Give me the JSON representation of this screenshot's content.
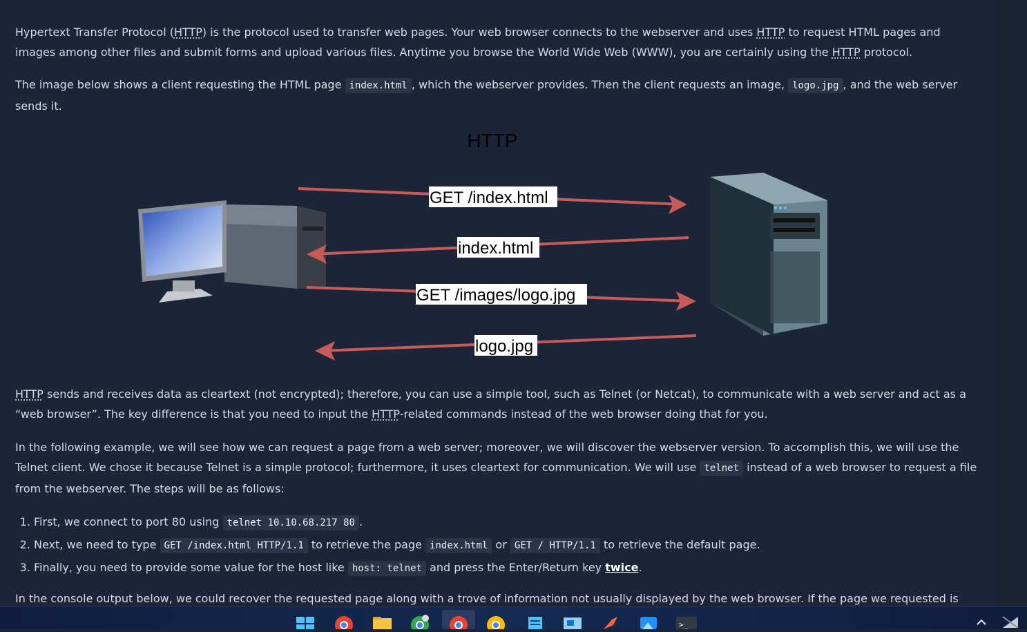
{
  "article": {
    "p1_a": "Hypertext Transfer Protocol (",
    "p1_abbr": "HTTP",
    "p1_b": ") is the protocol used to transfer web pages. Your web browser connects to the webserver and uses ",
    "p1_c": " to request HTML pages and images among other files and submit forms and upload various files. Anytime you browse the World Wide Web (WWW), you are certainly using the ",
    "p1_d": " protocol.",
    "p2_a": "The image below shows a client requesting the HTML page ",
    "p2_code1": "index.html",
    "p2_b": ", which the webserver provides. Then the client requests an image, ",
    "p2_code2": "logo.jpg",
    "p2_c": ", and the web server sends it.",
    "p3_a": " sends and receives data as cleartext (not encrypted); therefore, you can use a simple tool, such as Telnet (or Netcat), to communicate with a web server and act as a “web browser”. The key difference is that you need to input the ",
    "p3_b": "-related commands instead of the web browser doing that for you.",
    "p4_a": "In the following example, we will see how we can request a page from a web server; moreover, we will discover the webserver version. To accomplish this, we will use the Telnet client. We chose it because Telnet is a simple protocol; furthermore, it uses cleartext for communication. We will use ",
    "p4_code": "telnet",
    "p4_b": " instead of a web browser to request a file from the webserver. The steps will be as follows:",
    "li1_a": "First, we connect to port 80 using ",
    "li1_code": "telnet 10.10.68.217 80",
    "li1_b": ".",
    "li2_a": "Next, we need to type ",
    "li2_code1": "GET /index.html HTTP/1.1",
    "li2_b": " to retrieve the page ",
    "li2_code2": "index.html",
    "li2_c": " or ",
    "li2_code3": "GET / HTTP/1.1",
    "li2_d": " to retrieve the default page.",
    "li3_a": "Finally, you need to provide some value for the host like ",
    "li3_code": "host: telnet",
    "li3_b": " and press the Enter/Return key ",
    "li3_strong": "twice",
    "li3_c": ".",
    "p5": "In the console output below, we could recover the requested page along with a trove of information not usually displayed by the web browser. If the page we requested is not found, we"
  },
  "diagram": {
    "title": "HTTP",
    "label1": "GET /index.html",
    "label2": "index.html",
    "label3": "GET /images/logo.jpg",
    "label4": "logo.jpg",
    "arrow_color": "#c95a5a"
  },
  "taskbar": {
    "icons": [
      "windows-start-icon",
      "chrome-icon",
      "file-explorer-icon",
      "chrome-profile-icon",
      "chrome-active-icon",
      "chrome-alt-icon",
      "notepad-icon",
      "remote-desktop-icon",
      "burp-suite-icon",
      "photos-icon",
      "terminal-icon"
    ]
  }
}
